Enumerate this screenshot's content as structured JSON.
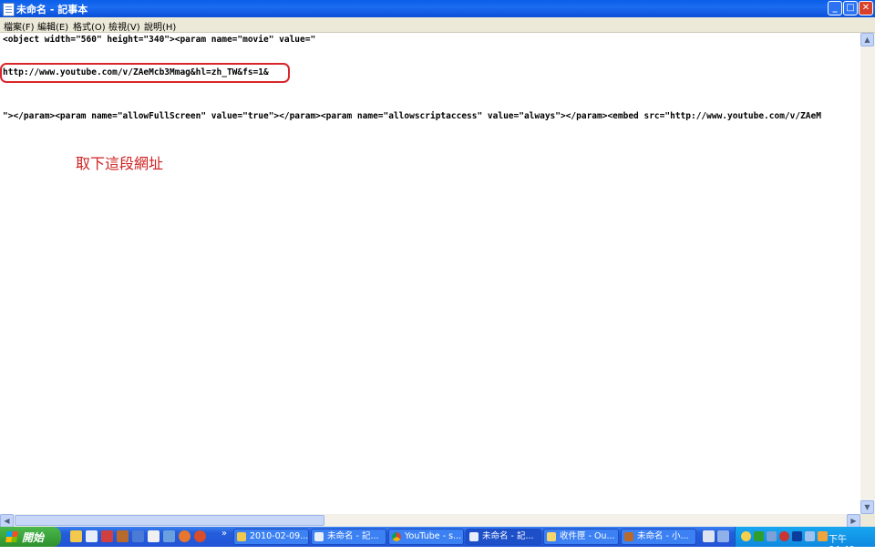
{
  "window": {
    "title": "未命名 - 記事本"
  },
  "menu": [
    "檔案(F)",
    "編輯(E)",
    "格式(O)",
    "檢視(V)",
    "說明(H)"
  ],
  "editor": {
    "lines": [
      "<object width=\"560\" height=\"340\"><param name=\"movie\" value=\"",
      "http://www.youtube.com/v/ZAeMcb3Mmag&hl=zh_TW&fs=1&",
      "\"></param><param name=\"allowFullScreen\" value=\"true\"></param><param name=\"allowscriptaccess\" value=\"always\"></param><embed src=\"http://www.youtube.com/v/ZAeM"
    ],
    "annotation": "取下這段網址"
  },
  "taskbar": {
    "start_label": "開始",
    "buttons": [
      {
        "label": "2010-02-09...",
        "icon": "folder-icon"
      },
      {
        "label": "未命名 - 記...",
        "icon": "notepad-icon"
      },
      {
        "label": "YouTube - s...",
        "icon": "chrome-icon"
      },
      {
        "label": "未命名 - 記...",
        "icon": "notepad-icon",
        "active": true
      },
      {
        "label": "收件匣 - Ou...",
        "icon": "outlook-icon"
      },
      {
        "label": "未命名 - 小...",
        "icon": "paint-icon"
      }
    ],
    "clock": "下午 04:49"
  },
  "colors": {
    "titlebar": "#0a5ee8",
    "highlight": "#d9262b",
    "annotation": "#d02020",
    "taskbar": "#245edb",
    "start": "#3c9e3c"
  }
}
